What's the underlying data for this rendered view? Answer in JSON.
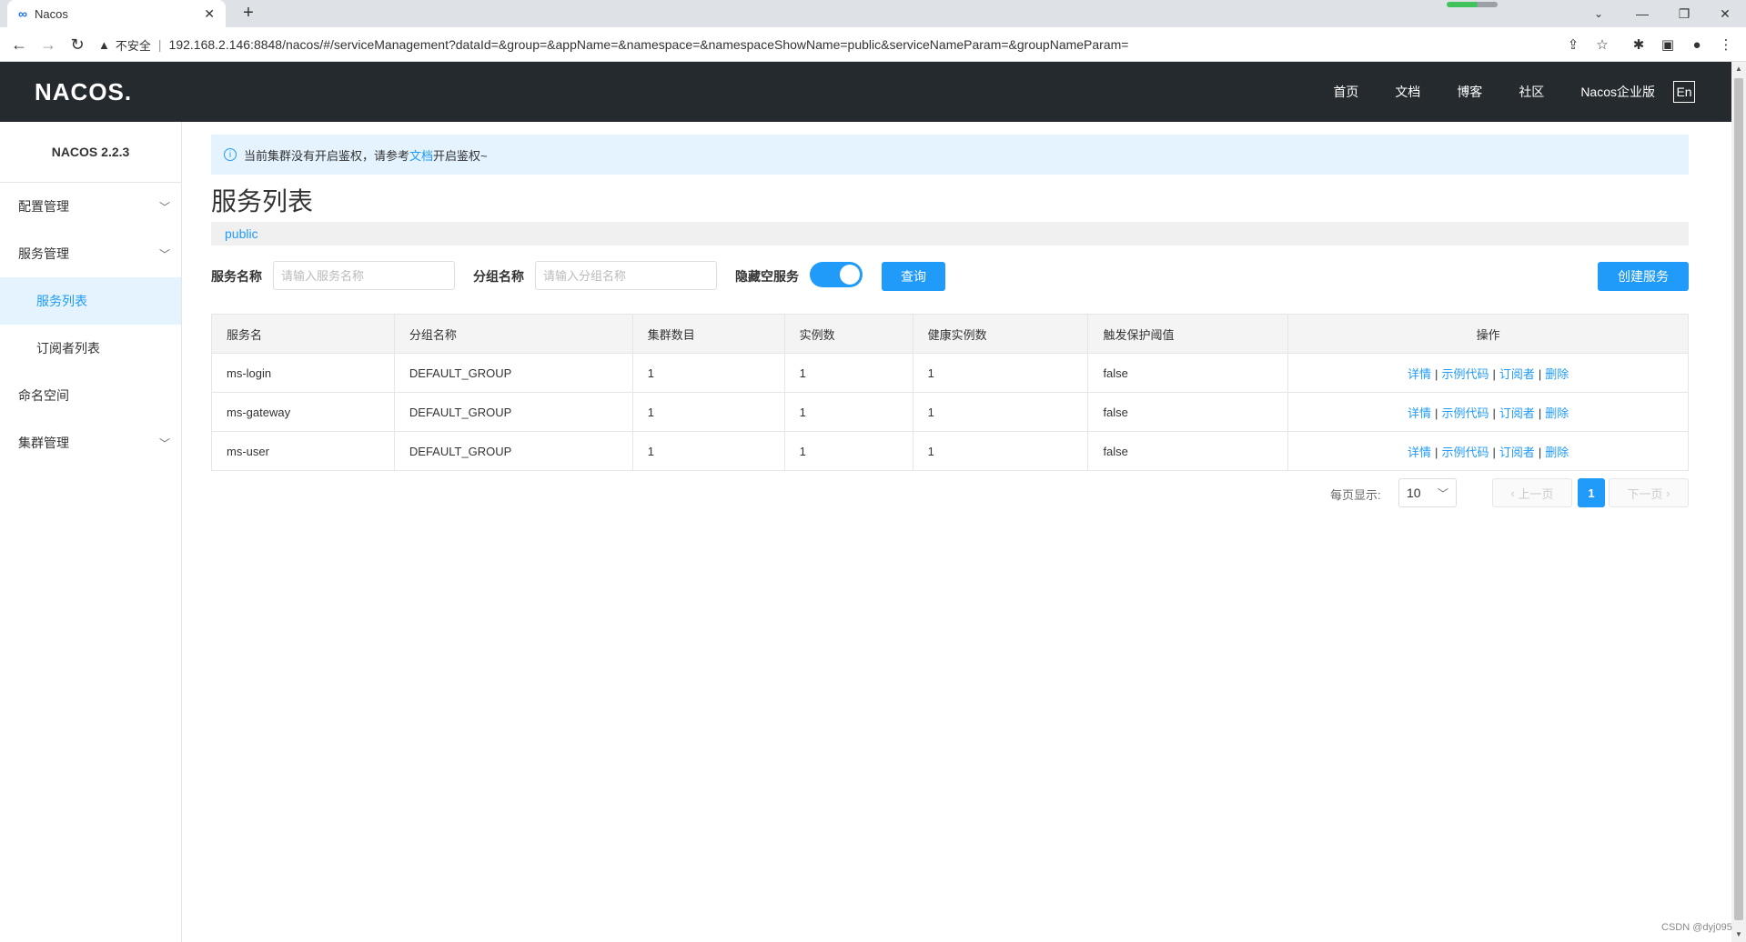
{
  "browser": {
    "tab_title": "Nacos",
    "tab_close": "✕",
    "new_tab": "+",
    "insecure_label": "不安全",
    "url": "192.168.2.146:8848/nacos/#/serviceManagement?dataId=&group=&appName=&namespace=&namespaceShowName=public&serviceNameParam=&groupNameParam="
  },
  "header": {
    "logo": "NACOS.",
    "nav": [
      "首页",
      "文档",
      "博客",
      "社区",
      "Nacos企业版"
    ],
    "lang": "En"
  },
  "sidebar": {
    "version": "NACOS 2.2.3",
    "items": [
      {
        "label": "配置管理"
      },
      {
        "label": "服务管理"
      },
      {
        "label": "服务列表"
      },
      {
        "label": "订阅者列表"
      },
      {
        "label": "命名空间"
      },
      {
        "label": "集群管理"
      }
    ]
  },
  "notice": {
    "before": "当前集群没有开启鉴权，请参考",
    "link": "文档",
    "after": "开启鉴权~"
  },
  "page": {
    "title": "服务列表",
    "namespace": "public"
  },
  "filters": {
    "service_name_label": "服务名称",
    "service_name_placeholder": "请输入服务名称",
    "group_name_label": "分组名称",
    "group_name_placeholder": "请输入分组名称",
    "hide_empty_label": "隐藏空服务",
    "query_label": "查询",
    "create_label": "创建服务"
  },
  "table": {
    "columns": [
      "服务名",
      "分组名称",
      "集群数目",
      "实例数",
      "健康实例数",
      "触发保护阈值",
      "操作"
    ],
    "rows": [
      {
        "name": "ms-login",
        "group": "DEFAULT_GROUP",
        "clusters": "1",
        "instances": "1",
        "healthy": "1",
        "protect": "false"
      },
      {
        "name": "ms-gateway",
        "group": "DEFAULT_GROUP",
        "clusters": "1",
        "instances": "1",
        "healthy": "1",
        "protect": "false"
      },
      {
        "name": "ms-user",
        "group": "DEFAULT_GROUP",
        "clusters": "1",
        "instances": "1",
        "healthy": "1",
        "protect": "false"
      }
    ],
    "ops": {
      "detail": "详情",
      "sample": "示例代码",
      "subscriber": "订阅者",
      "delete": "删除",
      "sep": "|"
    }
  },
  "pager": {
    "page_size_label": "每页显示:",
    "page_size": "10",
    "prev": "上一页",
    "next": "下一页",
    "current": "1"
  },
  "watermark": "CSDN @dyj095",
  "colors": {
    "accent": "#209bfa",
    "header_bg": "#252a2f"
  }
}
